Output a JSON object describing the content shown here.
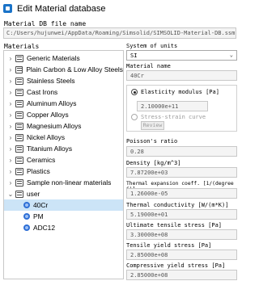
{
  "window": {
    "title": "Edit Material database",
    "icon": "app-icon"
  },
  "file": {
    "label": "Material DB file name",
    "path": "C:/Users/hujunwei/AppData/Roaming/Simsolid/SIMSOLID-Material-DB.ssm"
  },
  "materials": {
    "label": "Materials",
    "tree": [
      {
        "label": "Generic Materials",
        "expanded": false
      },
      {
        "label": "Plain Carbon & Low Alloy Steels",
        "expanded": false
      },
      {
        "label": "Stainless Steels",
        "expanded": false
      },
      {
        "label": "Cast Irons",
        "expanded": false
      },
      {
        "label": "Aluminum Alloys",
        "expanded": false
      },
      {
        "label": "Copper Alloys",
        "expanded": false
      },
      {
        "label": "Magnesium Alloys",
        "expanded": false
      },
      {
        "label": "Nickel Alloys",
        "expanded": false
      },
      {
        "label": "Titanium Alloys",
        "expanded": false
      },
      {
        "label": "Ceramics",
        "expanded": false
      },
      {
        "label": "Plastics",
        "expanded": false
      },
      {
        "label": "Sample non-linear materials",
        "expanded": false
      },
      {
        "label": "user",
        "expanded": true
      }
    ],
    "user_materials": [
      {
        "label": "40Cr",
        "selected": true
      },
      {
        "label": "PM",
        "selected": false
      },
      {
        "label": "ADC12",
        "selected": false
      }
    ]
  },
  "properties": {
    "units_label": "System of units",
    "units_value": "SI",
    "name_label": "Material name",
    "name_value": "40Cr",
    "elasticity_label": "Elasticity modulus [Pa]",
    "elasticity_value": "2.10000e+11",
    "stress_strain_label": "Stress-strain curve",
    "review_label": "Review",
    "poisson_label": "Poisson's ratio",
    "poisson_value": "0.28",
    "density_label": "Density [kg/m^3]",
    "density_value": "7.87200e+03",
    "expansion_label": "Thermal expansion coeff. [1/(degree C)]",
    "expansion_value": "1.26000e-05",
    "conductivity_label": "Thermal conductivity [W/(m*K)]",
    "conductivity_value": "5.19000e+01",
    "uts_label": "Ultimate tensile stress [Pa]",
    "uts_value": "3.30000e+08",
    "tys_label": "Tensile yield stress [Pa]",
    "tys_value": "2.85000e+08",
    "cys_label": "Compressive yield stress [Pa]",
    "cys_value": "2.85000e+08"
  },
  "colors": {
    "selection": "#cce4f7",
    "accent": "#2e6fd6"
  }
}
